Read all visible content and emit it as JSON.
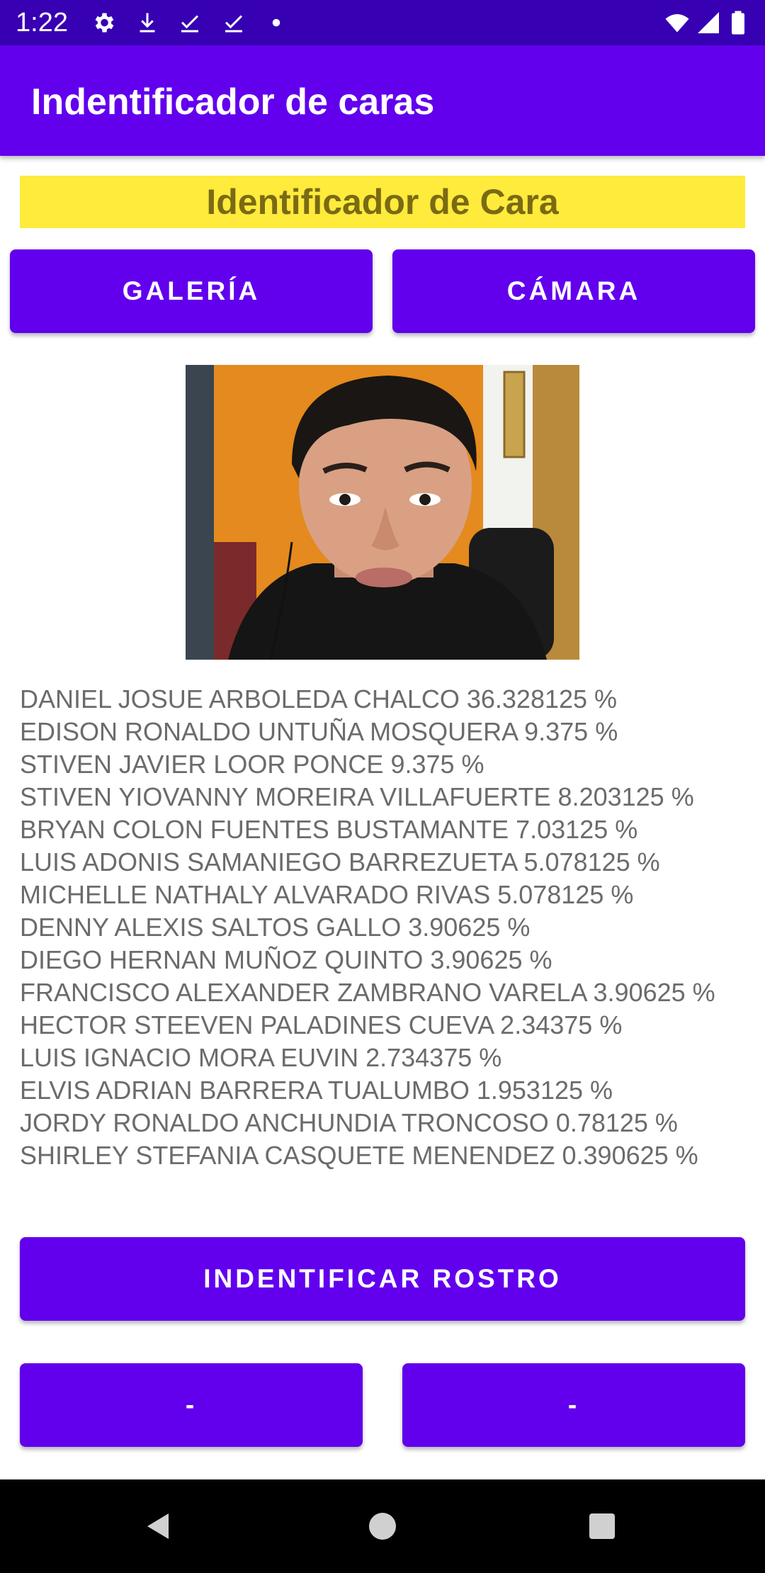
{
  "status_bar": {
    "time": "1:22",
    "icons": [
      "gear-icon",
      "download-icon",
      "check-icon",
      "check-icon",
      "dot-icon",
      "wifi-icon",
      "signal-icon",
      "battery-icon"
    ]
  },
  "app_bar": {
    "title": "Indentificador de caras"
  },
  "banner": {
    "text": "Identificador de Cara"
  },
  "buttons": {
    "gallery": "GALERÍA",
    "camera": "CÁMARA",
    "identify": "INDENTIFICAR ROSTRO",
    "left": "-",
    "right": "-"
  },
  "results": [
    "DANIEL JOSUE ARBOLEDA CHALCO 36.328125 %",
    "EDISON RONALDO UNTUÑA MOSQUERA 9.375 %",
    "STIVEN JAVIER LOOR PONCE 9.375 %",
    "STIVEN YIOVANNY MOREIRA VILLAFUERTE 8.203125 %",
    "BRYAN COLON FUENTES BUSTAMANTE 7.03125 %",
    "LUIS ADONIS SAMANIEGO BARREZUETA 5.078125 %",
    "MICHELLE NATHALY ALVARADO RIVAS 5.078125 %",
    "DENNY ALEXIS SALTOS GALLO 3.90625 %",
    "DIEGO HERNAN MUÑOZ QUINTO 3.90625 %",
    "FRANCISCO ALEXANDER ZAMBRANO VARELA 3.90625 %",
    "HECTOR STEEVEN PALADINES CUEVA 2.34375 %",
    "LUIS IGNACIO MORA EUVIN 2.734375 %",
    "ELVIS ADRIAN BARRERA TUALUMBO 1.953125 %",
    "JORDY RONALDO ANCHUNDIA TRONCOSO 0.78125 %",
    "SHIRLEY STEFANIA CASQUETE MENENDEZ 0.390625 %"
  ],
  "colors": {
    "status_bar": "#3700b3",
    "primary": "#6200ee",
    "banner_bg": "#ffeb3b",
    "banner_text": "#7a6a14",
    "result_text": "#6b6b6b",
    "nav_bar": "#000000"
  },
  "nav_bar": {
    "icons": [
      "back-icon",
      "home-icon",
      "recents-icon"
    ]
  }
}
